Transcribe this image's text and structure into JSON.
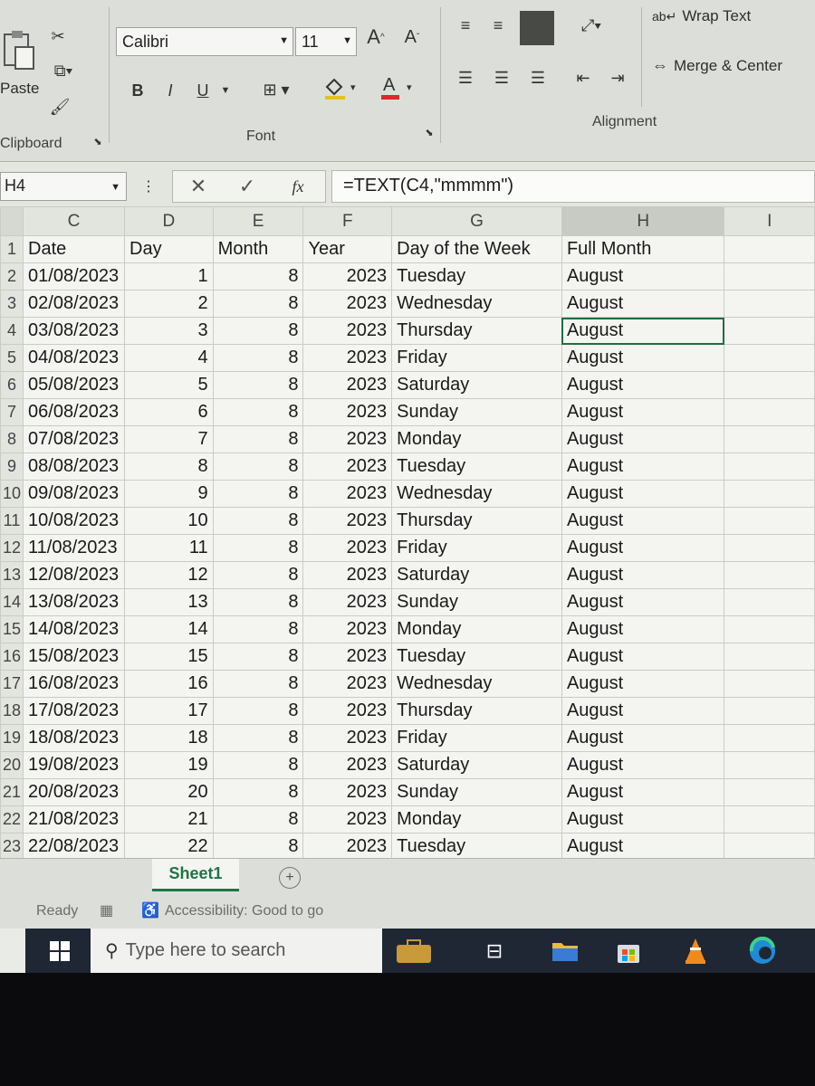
{
  "ribbon": {
    "paste_label": "Paste",
    "clipboard_label": "Clipboard",
    "font_name": "Calibri",
    "font_size": "11",
    "bold": "B",
    "italic": "I",
    "underline": "U",
    "font_label": "Font",
    "wrap_text": "Wrap Text",
    "merge_center": "Merge & Center",
    "alignment_label": "Alignment"
  },
  "formula_bar": {
    "name_box": "H4",
    "fx": "fx",
    "formula": "=TEXT(C4,\"mmmm\")"
  },
  "columns": [
    "C",
    "D",
    "E",
    "F",
    "G",
    "H",
    "I"
  ],
  "header_row": {
    "row": "1",
    "cells": [
      "Date",
      "Day",
      "Month",
      "Year",
      "Day of the Week",
      "Full Month",
      ""
    ]
  },
  "rows": [
    {
      "row": "2",
      "date": "01/08/2023",
      "day": "1",
      "month": "8",
      "year": "2023",
      "weekday": "Tuesday",
      "full_month": "August"
    },
    {
      "row": "3",
      "date": "02/08/2023",
      "day": "2",
      "month": "8",
      "year": "2023",
      "weekday": "Wednesday",
      "full_month": "August"
    },
    {
      "row": "4",
      "date": "03/08/2023",
      "day": "3",
      "month": "8",
      "year": "2023",
      "weekday": "Thursday",
      "full_month": "August"
    },
    {
      "row": "5",
      "date": "04/08/2023",
      "day": "4",
      "month": "8",
      "year": "2023",
      "weekday": "Friday",
      "full_month": "August"
    },
    {
      "row": "6",
      "date": "05/08/2023",
      "day": "5",
      "month": "8",
      "year": "2023",
      "weekday": "Saturday",
      "full_month": "August"
    },
    {
      "row": "7",
      "date": "06/08/2023",
      "day": "6",
      "month": "8",
      "year": "2023",
      "weekday": "Sunday",
      "full_month": "August"
    },
    {
      "row": "8",
      "date": "07/08/2023",
      "day": "7",
      "month": "8",
      "year": "2023",
      "weekday": "Monday",
      "full_month": "August"
    },
    {
      "row": "9",
      "date": "08/08/2023",
      "day": "8",
      "month": "8",
      "year": "2023",
      "weekday": "Tuesday",
      "full_month": "August"
    },
    {
      "row": "10",
      "date": "09/08/2023",
      "day": "9",
      "month": "8",
      "year": "2023",
      "weekday": "Wednesday",
      "full_month": "August"
    },
    {
      "row": "11",
      "date": "10/08/2023",
      "day": "10",
      "month": "8",
      "year": "2023",
      "weekday": "Thursday",
      "full_month": "August"
    },
    {
      "row": "12",
      "date": "11/08/2023",
      "day": "11",
      "month": "8",
      "year": "2023",
      "weekday": "Friday",
      "full_month": "August"
    },
    {
      "row": "13",
      "date": "12/08/2023",
      "day": "12",
      "month": "8",
      "year": "2023",
      "weekday": "Saturday",
      "full_month": "August"
    },
    {
      "row": "14",
      "date": "13/08/2023",
      "day": "13",
      "month": "8",
      "year": "2023",
      "weekday": "Sunday",
      "full_month": "August"
    },
    {
      "row": "15",
      "date": "14/08/2023",
      "day": "14",
      "month": "8",
      "year": "2023",
      "weekday": "Monday",
      "full_month": "August"
    },
    {
      "row": "16",
      "date": "15/08/2023",
      "day": "15",
      "month": "8",
      "year": "2023",
      "weekday": "Tuesday",
      "full_month": "August"
    },
    {
      "row": "17",
      "date": "16/08/2023",
      "day": "16",
      "month": "8",
      "year": "2023",
      "weekday": "Wednesday",
      "full_month": "August"
    },
    {
      "row": "18",
      "date": "17/08/2023",
      "day": "17",
      "month": "8",
      "year": "2023",
      "weekday": "Thursday",
      "full_month": "August"
    },
    {
      "row": "19",
      "date": "18/08/2023",
      "day": "18",
      "month": "8",
      "year": "2023",
      "weekday": "Friday",
      "full_month": "August"
    },
    {
      "row": "20",
      "date": "19/08/2023",
      "day": "19",
      "month": "8",
      "year": "2023",
      "weekday": "Saturday",
      "full_month": "August"
    },
    {
      "row": "21",
      "date": "20/08/2023",
      "day": "20",
      "month": "8",
      "year": "2023",
      "weekday": "Sunday",
      "full_month": "August"
    },
    {
      "row": "22",
      "date": "21/08/2023",
      "day": "21",
      "month": "8",
      "year": "2023",
      "weekday": "Monday",
      "full_month": "August"
    },
    {
      "row": "23",
      "date": "22/08/2023",
      "day": "22",
      "month": "8",
      "year": "2023",
      "weekday": "Tuesday",
      "full_month": "August"
    }
  ],
  "active_cell": {
    "row": "4",
    "column": "H"
  },
  "sheet_tabs": [
    "Sheet1"
  ],
  "status_bar": {
    "ready": "Ready",
    "accessibility": "Accessibility: Good to go"
  },
  "taskbar": {
    "search_placeholder": "Type here to search",
    "icons": [
      "windows-start-icon",
      "search-icon",
      "briefcase-icon",
      "task-view-icon",
      "file-explorer-icon",
      "store-icon",
      "vlc-icon",
      "edge-icon"
    ]
  },
  "colors": {
    "excel_green": "#217346",
    "selection_border": "#1f6e3f",
    "taskbar": "#1e2733"
  }
}
